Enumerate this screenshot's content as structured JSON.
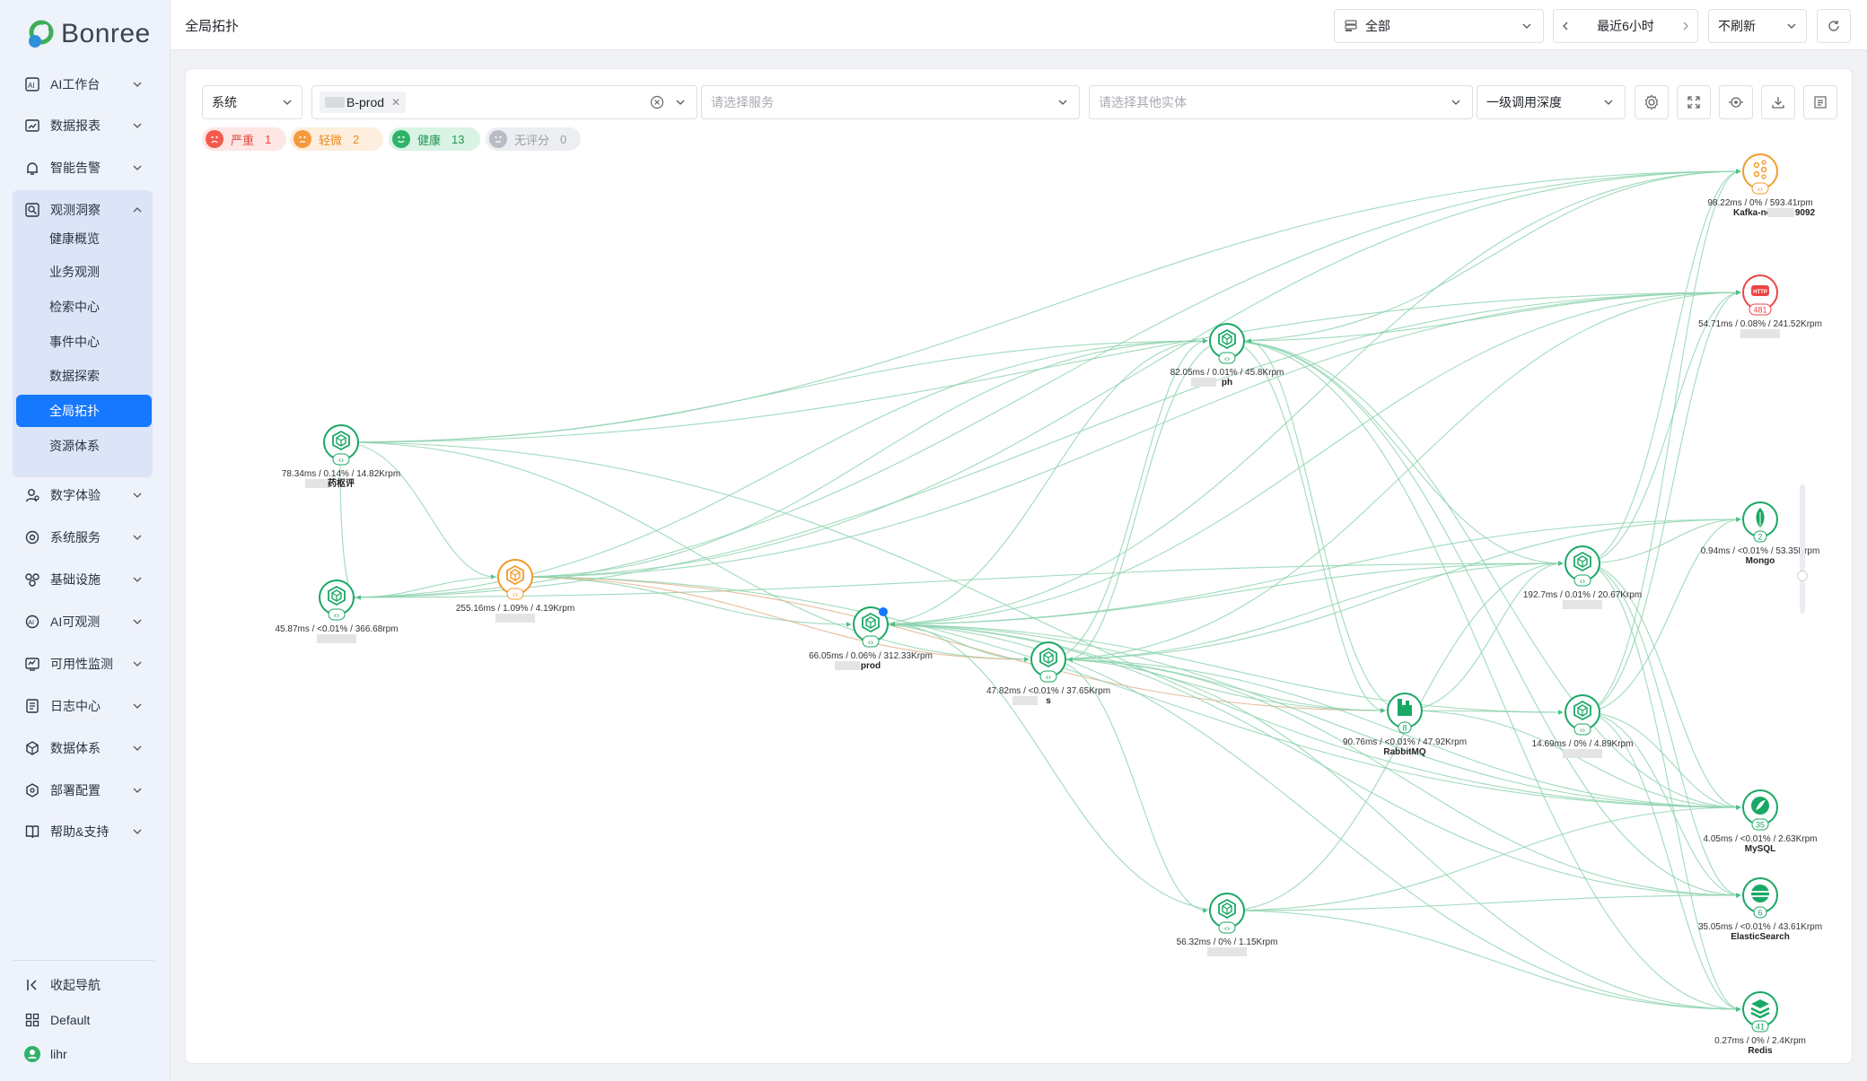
{
  "brand": {
    "logo_text": "Bonree"
  },
  "sidebar": {
    "items": [
      {
        "label": "AI工作台",
        "icon": "ai-workbench-icon"
      },
      {
        "label": "数据报表",
        "icon": "report-icon"
      },
      {
        "label": "智能告警",
        "icon": "alarm-icon"
      },
      {
        "label": "观测洞察",
        "icon": "observe-icon",
        "expanded": true
      },
      {
        "label": "数字体验",
        "icon": "user-experience-icon"
      },
      {
        "label": "系统服务",
        "icon": "system-service-icon"
      },
      {
        "label": "基础设施",
        "icon": "infrastructure-icon"
      },
      {
        "label": "AI可观测",
        "icon": "ai-observe-icon"
      },
      {
        "label": "可用性监测",
        "icon": "availability-icon"
      },
      {
        "label": "日志中心",
        "icon": "log-icon"
      },
      {
        "label": "数据体系",
        "icon": "data-system-icon"
      },
      {
        "label": "部署配置",
        "icon": "deploy-icon"
      },
      {
        "label": "帮助&支持",
        "icon": "help-book-icon"
      }
    ],
    "sub_items": [
      "健康概览",
      "业务观测",
      "检索中心",
      "事件中心",
      "数据探索",
      "全局拓扑",
      "资源体系"
    ],
    "active_sub": "全局拓扑",
    "footer": {
      "collapse_label": "收起导航",
      "workspace_label": "Default",
      "user_label": "lihr"
    }
  },
  "header": {
    "title": "全局拓扑",
    "scope_select": "全部",
    "time_range": "最近6小时",
    "refresh_select": "不刷新"
  },
  "filters": {
    "type_select": "系统",
    "system_tag": "B-prod",
    "service_placeholder": "请选择服务",
    "entity_placeholder": "请选择其他实体",
    "depth_select": "一级调用深度"
  },
  "health_pills": [
    {
      "label": "严重",
      "count": "1",
      "color": "#f5594e",
      "bg": "#fde6e4",
      "text": "#e5483c"
    },
    {
      "label": "轻微",
      "count": "2",
      "color": "#f59a3c",
      "bg": "#fdeedd",
      "text": "#e88a24"
    },
    {
      "label": "健康",
      "count": "13",
      "color": "#2fb36a",
      "bg": "#d9f3e4",
      "text": "#1f9a55"
    },
    {
      "label": "无评分",
      "count": "0",
      "color": "#b8bcc4",
      "bg": "#eceef1",
      "text": "#9a9ea6"
    }
  ],
  "colors": {
    "healthy": "#1aa865",
    "warning": "#f29b2c",
    "critical": "#ef4444",
    "accent": "#1677ff",
    "edge": "#8fd3b0"
  },
  "nodes": [
    {
      "id": "yaozhi",
      "kind": "service",
      "status": "healthy",
      "metrics": "78.34ms  /  0.14%  /  14.82Krpm",
      "name": "药枢评"
    },
    {
      "id": "n-left",
      "kind": "service",
      "status": "healthy",
      "metrics": "45.87ms  /  <0.01%  /  366.68rpm",
      "name": ""
    },
    {
      "id": "n-warn",
      "kind": "service",
      "status": "warning",
      "metrics": "255.16ms  /  1.09%  /  4.19Krpm",
      "name": ""
    },
    {
      "id": "n-prod",
      "kind": "service",
      "status": "healthy",
      "metrics": "66.05ms  /  0.06%  /  312.33Krpm",
      "name": "prod"
    },
    {
      "id": "n-mid",
      "kind": "service",
      "status": "healthy",
      "metrics": "47.82ms  /  <0.01%  /  37.65Krpm",
      "name": "s"
    },
    {
      "id": "n-ph",
      "kind": "service",
      "status": "healthy",
      "metrics": "82.05ms  /  0.01%  /  45.8Krpm",
      "name": "ph"
    },
    {
      "id": "n-low",
      "kind": "service",
      "status": "healthy",
      "metrics": "56.32ms  /  0%  /  1.15Krpm",
      "name": ""
    },
    {
      "id": "rabbitmq",
      "kind": "rabbitmq",
      "status": "healthy",
      "badge": "8",
      "metrics": "90.76ms  /  <0.01%  /  47.92Krpm",
      "name": "RabbitMQ"
    },
    {
      "id": "n-r1",
      "kind": "service",
      "status": "healthy",
      "metrics": "192.7ms  /  0.01%  /  20.67Krpm",
      "name": ""
    },
    {
      "id": "n-r2",
      "kind": "service",
      "status": "healthy",
      "metrics": "14.69ms  /  0%  /  4.89Krpm",
      "name": ""
    },
    {
      "id": "kafka",
      "kind": "kafka",
      "status": "warning",
      "metrics": "98.22ms  /  0%  /  593.41rpm",
      "name": "Kafka-node0",
      "name_suffix": "9092"
    },
    {
      "id": "http",
      "kind": "http",
      "status": "critical",
      "badge": "481",
      "metrics": "54.71ms  /  0.08%  /  241.52Krpm",
      "name": ""
    },
    {
      "id": "mongo",
      "kind": "mongo",
      "status": "healthy",
      "badge": "2",
      "metrics": "0.94ms  /  <0.01%  /  53.35Krpm",
      "name": "Mongo"
    },
    {
      "id": "mysql",
      "kind": "mysql",
      "status": "healthy",
      "badge": "35",
      "metrics": "4.05ms  /  <0.01%  /  2.63Krpm",
      "name": "MySQL"
    },
    {
      "id": "es",
      "kind": "elasticsearch",
      "status": "healthy",
      "badge": "6",
      "metrics": "35.05ms  /  <0.01%  /  43.61Krpm",
      "name": "ElasticSearch"
    },
    {
      "id": "redis",
      "kind": "redis",
      "status": "healthy",
      "badge": "41",
      "metrics": "0.27ms  /  0%  /  2.4Krpm",
      "name": "Redis"
    }
  ],
  "edges": [
    [
      "yaozhi",
      "n-ph"
    ],
    [
      "yaozhi",
      "kafka"
    ],
    [
      "yaozhi",
      "http"
    ],
    [
      "yaozhi",
      "n-left"
    ],
    [
      "yaozhi",
      "n-warn"
    ],
    [
      "yaozhi",
      "n-mid"
    ],
    [
      "yaozhi",
      "mysql"
    ],
    [
      "n-left",
      "n-ph"
    ],
    [
      "n-left",
      "kafka"
    ],
    [
      "n-left",
      "http"
    ],
    [
      "n-left",
      "n-r1"
    ],
    [
      "n-warn",
      "n-left"
    ],
    [
      "n-warn",
      "n-prod"
    ],
    [
      "n-warn",
      "n-mid"
    ],
    [
      "n-warn",
      "n-ph"
    ],
    [
      "n-warn",
      "rabbitmq"
    ],
    [
      "n-warn",
      "kafka"
    ],
    [
      "n-warn",
      "http"
    ],
    [
      "n-warn",
      "mysql"
    ],
    [
      "n-prod",
      "n-ph"
    ],
    [
      "n-prod",
      "n-mid"
    ],
    [
      "n-prod",
      "rabbitmq"
    ],
    [
      "n-prod",
      "n-r1"
    ],
    [
      "n-prod",
      "n-r2"
    ],
    [
      "n-prod",
      "mongo"
    ],
    [
      "n-prod",
      "mysql"
    ],
    [
      "n-prod",
      "es"
    ],
    [
      "n-prod",
      "redis"
    ],
    [
      "n-prod",
      "http"
    ],
    [
      "n-prod",
      "kafka"
    ],
    [
      "n-mid",
      "rabbitmq"
    ],
    [
      "n-mid",
      "n-ph"
    ],
    [
      "n-mid",
      "mysql"
    ],
    [
      "n-mid",
      "redis"
    ],
    [
      "n-mid",
      "es"
    ],
    [
      "n-mid",
      "n-low"
    ],
    [
      "n-mid",
      "http"
    ],
    [
      "n-mid",
      "n-r1"
    ],
    [
      "n-mid",
      "mongo"
    ],
    [
      "n-ph",
      "rabbitmq"
    ],
    [
      "n-ph",
      "mysql"
    ],
    [
      "n-ph",
      "es"
    ],
    [
      "n-ph",
      "redis"
    ],
    [
      "n-ph",
      "n-r1"
    ],
    [
      "n-ph",
      "http"
    ],
    [
      "n-ph",
      "kafka"
    ],
    [
      "n-ph",
      "n-mid"
    ],
    [
      "n-low",
      "mysql"
    ],
    [
      "n-low",
      "redis"
    ],
    [
      "n-low",
      "es"
    ],
    [
      "n-low",
      "n-r1"
    ],
    [
      "n-low",
      "n-prod"
    ],
    [
      "rabbitmq",
      "n-r1"
    ],
    [
      "rabbitmq",
      "n-r2"
    ],
    [
      "rabbitmq",
      "n-ph"
    ],
    [
      "rabbitmq",
      "mysql"
    ],
    [
      "n-r1",
      "mysql"
    ],
    [
      "n-r1",
      "es"
    ],
    [
      "n-r1",
      "redis"
    ],
    [
      "n-r1",
      "kafka"
    ],
    [
      "n-r1",
      "http"
    ],
    [
      "n-r1",
      "mongo"
    ],
    [
      "n-r2",
      "mysql"
    ],
    [
      "n-r2",
      "es"
    ],
    [
      "n-r2",
      "redis"
    ],
    [
      "n-r2",
      "http"
    ],
    [
      "n-r2",
      "kafka"
    ],
    [
      "n-r2",
      "mongo"
    ]
  ]
}
